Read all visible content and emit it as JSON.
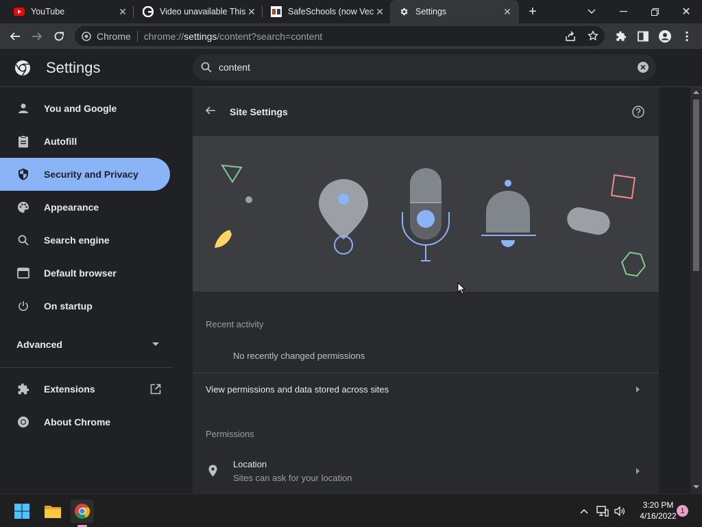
{
  "tabs": [
    {
      "title": "YouTube"
    },
    {
      "title": "Video unavailable This"
    },
    {
      "title": "SafeSchools (now Vect"
    },
    {
      "title": "Settings"
    }
  ],
  "toolbar": {
    "omnibox_chip": "Chrome",
    "url_prefix": "chrome://",
    "url_host": "settings",
    "url_path": "/content?search=content"
  },
  "header": {
    "title": "Settings",
    "search_value": "content"
  },
  "sidebar": {
    "items": [
      {
        "label": "You and Google"
      },
      {
        "label": "Autofill"
      },
      {
        "label": "Security and Privacy"
      },
      {
        "label": "Appearance"
      },
      {
        "label": "Search engine"
      },
      {
        "label": "Default browser"
      },
      {
        "label": "On startup"
      }
    ],
    "advanced_label": "Advanced",
    "extensions_label": "Extensions",
    "about_label": "About Chrome"
  },
  "main": {
    "title": "Site Settings",
    "recent_activity_label": "Recent activity",
    "no_recent_text": "No recently changed permissions",
    "view_permissions_text": "View permissions and data stored across sites",
    "permissions_label": "Permissions",
    "location_title": "Location",
    "location_sub": "Sites can ask for your location"
  },
  "taskbar": {
    "time": "3:20 PM",
    "date": "4/16/2022",
    "notification_count": "1"
  },
  "colors": {
    "accent": "#8ab4f8",
    "background": "#202124",
    "surface": "#292a2d",
    "banner": "#3c3d40"
  }
}
